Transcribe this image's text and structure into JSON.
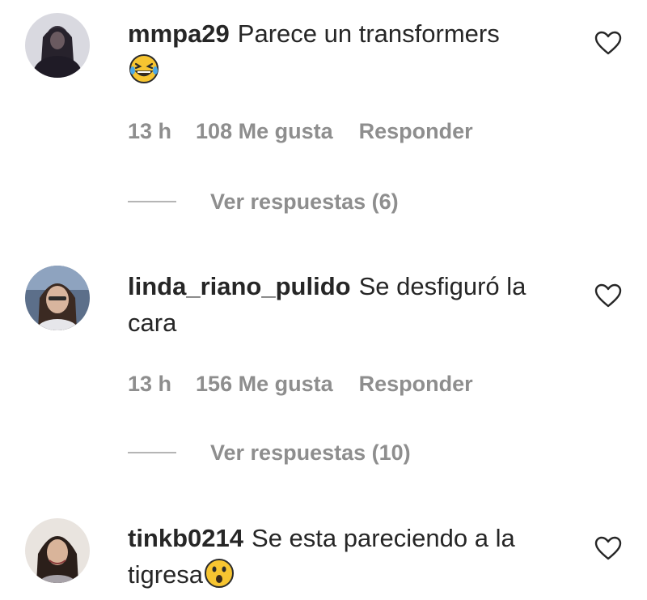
{
  "comments": [
    {
      "username": "mmpa29",
      "text": "Parece un transformers",
      "emoji": "laughing-tears-emoji",
      "time": "13 h",
      "likes": "108 Me gusta",
      "reply_label": "Responder",
      "view_replies": "Ver respuestas (6)"
    },
    {
      "username": "linda_riano_pulido",
      "text": "Se desfiguró la cara",
      "time": "13 h",
      "likes": "156 Me gusta",
      "reply_label": "Responder",
      "view_replies": "Ver respuestas (10)"
    },
    {
      "username": "tinkb0214",
      "text": "Se esta pareciendo a la tigresa",
      "emoji": "astonished-face-emoji"
    }
  ],
  "colors": {
    "text": "#262626",
    "muted": "#8e8e8e",
    "emoji_yellow": "#f7c531"
  }
}
